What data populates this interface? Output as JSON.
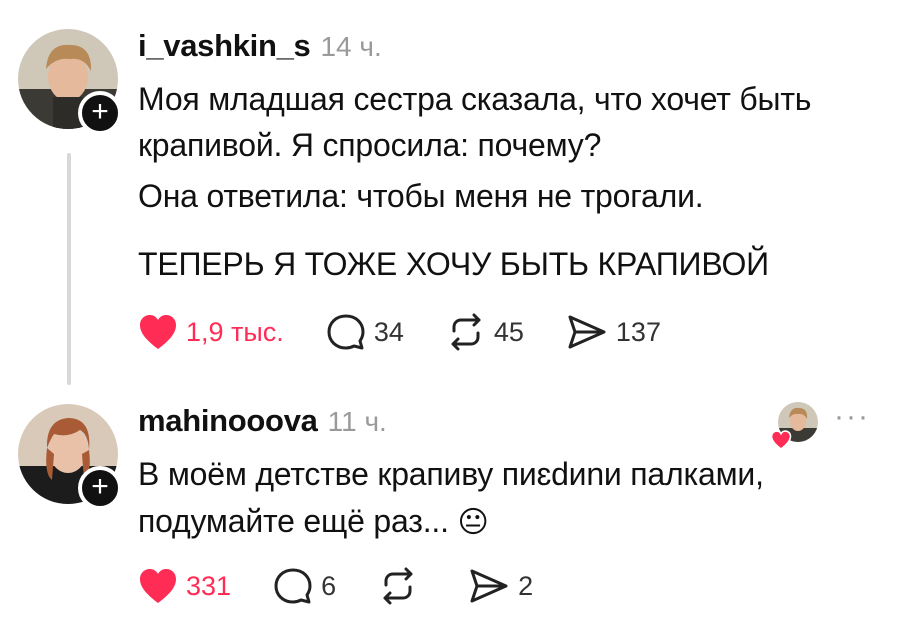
{
  "posts": [
    {
      "username": "i_vashkin_s",
      "time": "14 ч.",
      "lines": [
        "Моя младшая сестра сказала, что хочет быть",
        "крапивой. Я спросила: почему?",
        "Она ответила: чтобы меня не трогали.",
        "ТЕПЕРЬ Я ТОЖЕ ХОЧУ БЫТЬ КРАПИВОЙ"
      ],
      "likes": "1,9 тыс.",
      "comments": "34",
      "reposts": "45",
      "shares": "137",
      "liked": true
    },
    {
      "username": "mahinooova",
      "time": "11 ч.",
      "lines": [
        "В моём детстве крапиву пиɛdиnи палками,",
        "подумайте ещё раз..."
      ],
      "emoji": "😐",
      "likes": "331",
      "comments": "6",
      "reposts": "",
      "shares": "2",
      "liked": true,
      "more": "···"
    }
  ],
  "icons": {
    "heart": "heart-icon",
    "comment": "comment-icon",
    "repost": "repost-icon",
    "share": "share-icon",
    "follow": "plus-icon"
  },
  "colors": {
    "like": "#ff2d55",
    "text": "#111111",
    "muted": "#9a9a9a",
    "follow_button": "#111111"
  },
  "follow_symbol": "+"
}
